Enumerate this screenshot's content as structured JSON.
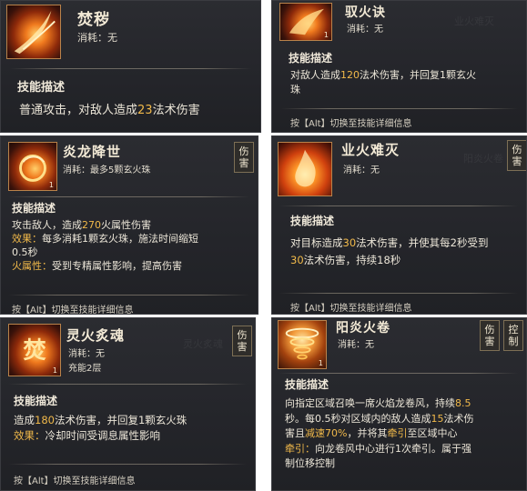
{
  "cards": [
    {
      "title": "焚秽",
      "cost_label": "消耗：",
      "cost_value": "无",
      "section": "技能描述",
      "desc": [
        "普通攻击，对敌人造成",
        "23",
        "法术伤害"
      ],
      "level": ""
    },
    {
      "title": "驭火诀",
      "cost_label": "消耗：",
      "cost_value": "无",
      "section": "技能描述",
      "desc_line1": [
        "对敌人造成",
        "120",
        "法术伤害，并回复1颗玄火"
      ],
      "desc_line2": "珠",
      "footer": "按【Alt】切换至技能详细信息",
      "level": "1"
    },
    {
      "title": "炎龙降世",
      "cost_label": "消耗：",
      "cost_value": "最多5颗玄火珠",
      "tag": "伤害",
      "section": "技能描述",
      "line1": [
        "攻击敌人，造成",
        "270",
        "火属性伤害"
      ],
      "line2_label": "效果：",
      "line2": "每多消耗1颗玄火珠，施法时间缩短",
      "line3": "0.5秒",
      "line4_label": "火属性：",
      "line4": "受到专精属性影响，提高伤害",
      "footer": "按【Alt】切换至技能详细信息",
      "level": "1"
    },
    {
      "title": "业火难灭",
      "cost_label": "消耗：",
      "cost_value": "无",
      "tag": "伤害",
      "section": "技能描述",
      "line1": [
        "对目标造成",
        "30",
        "法术伤害，并使其每2秒受到"
      ],
      "line2": [
        "30",
        "法术伤害，持续18秒"
      ],
      "footer": "按【Alt】切换至技能详细信息",
      "level": ""
    },
    {
      "title": "灵火炙魂",
      "cost_label": "消耗：",
      "cost_value": "无",
      "charges": "充能2层",
      "tag": "伤害",
      "section": "技能描述",
      "line1": [
        "造成",
        "180",
        "法术伤害，并回复1颗玄火珠"
      ],
      "line2_label": "效果：",
      "line2": "冷却时间受调息属性影响",
      "footer": "按【Alt】切换至技能详细信息",
      "level": "1"
    },
    {
      "title": "阳炎火卷",
      "cost_label": "消耗：",
      "cost_value": "无",
      "tag1": "伤害",
      "tag2": "控制",
      "section": "技能描述",
      "line1": [
        "向指定区域召唤一席火焰龙卷风，持续",
        "8.5"
      ],
      "line2": [
        "秒。每0.5秒对区域内的敌人造成",
        "15",
        "法术伤"
      ],
      "line3": [
        "害且",
        "减速70%",
        "，并将其",
        "牵引",
        "至区域中心"
      ],
      "line4_label": "牵引：",
      "line4": "向龙卷风中心进行1次牵引。属于强",
      "line5": "制位移控制",
      "level": "1"
    }
  ],
  "colors": {
    "highlight": "#f1b94a",
    "card_bg": "#26272c",
    "tag_border": "#7d6f55"
  },
  "icons": [
    "flame-slash-icon",
    "fire-bird-icon",
    "fire-dragon-icon",
    "burning-flames-icon",
    "spirit-fire-icon",
    "fire-tornado-icon"
  ]
}
